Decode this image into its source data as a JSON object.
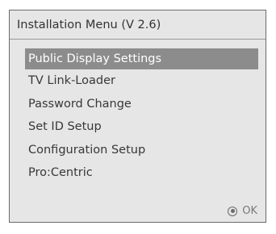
{
  "menu": {
    "title": "Installation Menu (V 2.6)",
    "items": [
      {
        "label": "Public Display Settings",
        "selected": true
      },
      {
        "label": "TV Link-Loader",
        "selected": false
      },
      {
        "label": "Password Change",
        "selected": false
      },
      {
        "label": "Set ID Setup",
        "selected": false
      },
      {
        "label": "Configuration Setup",
        "selected": false
      },
      {
        "label": "Pro:Centric",
        "selected": false
      }
    ],
    "footer": {
      "ok_icon": "ok-button-icon",
      "ok_label": "OK"
    }
  },
  "colors": {
    "panel_background": "#e6e6e6",
    "selected_background": "#8c8c8c",
    "selected_text": "#ffffff",
    "text": "#383838"
  }
}
